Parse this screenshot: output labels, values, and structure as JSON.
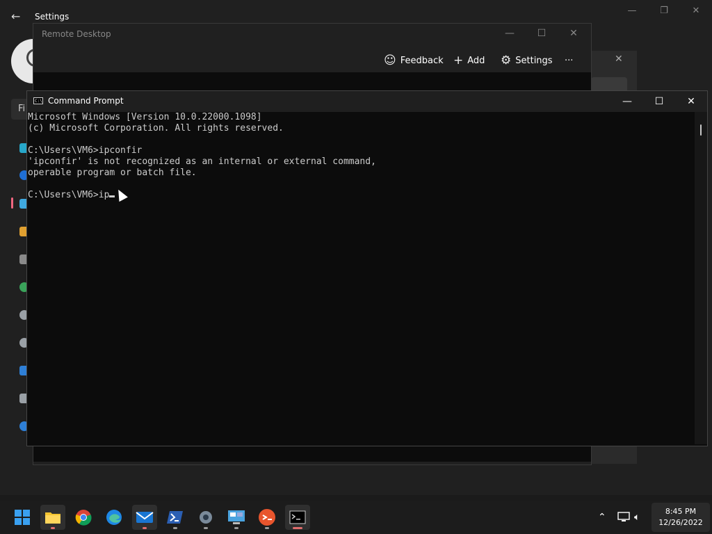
{
  "settings": {
    "title": "Settings",
    "back_glyph": "←",
    "search_placeholder": "Fi"
  },
  "remote_desktop": {
    "title": "Remote Desktop",
    "toolbar": {
      "feedback_label": "Feedback",
      "add_label": "Add",
      "settings_label": "Settings",
      "more_glyph": "···"
    }
  },
  "cmd": {
    "title": "Command Prompt",
    "lines": [
      "Microsoft Windows [Version 10.0.22000.1098]",
      "(c) Microsoft Corporation. All rights reserved.",
      "",
      "C:\\Users\\VM6>ipconfir",
      "'ipconfir' is not recognized as an internal or external command,",
      "operable program or batch file.",
      "",
      "C:\\Users\\VM6>ip"
    ]
  },
  "taskbar": {
    "icons": [
      "windows-start-icon",
      "file-explorer-icon",
      "chrome-icon",
      "edge-icon",
      "mail-icon",
      "powershell-icon",
      "settings-gear-icon",
      "control-panel-icon",
      "remote-desktop-icon",
      "command-prompt-icon"
    ],
    "time": "8:45 PM",
    "date": "12/26/2022"
  },
  "colors": {
    "accent_red": "#f06680",
    "cmd_text": "#cccccc",
    "cmd_bg": "#0c0c0c"
  }
}
